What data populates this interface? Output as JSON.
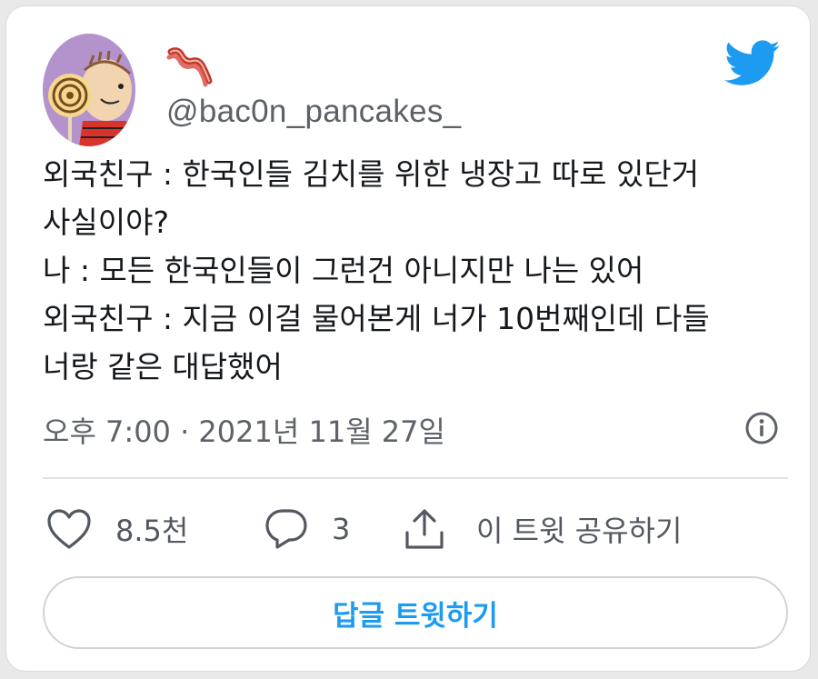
{
  "author": {
    "handle": "@bac0n_pancakes_",
    "display_name_icon": "bacon-emoji",
    "avatar": "linus-lollipop-avatar"
  },
  "brand": {
    "logo_icon": "twitter-bird-icon",
    "accent_color": "#1d9bf0"
  },
  "tweet": {
    "lines": [
      "외국친구 : 한국인들 김치를 위한 냉장고 따로 있단거",
      "사실이야?",
      "나 : 모든 한국인들이 그런건 아니지만 나는 있어",
      "외국친구 : 지금 이걸 물어본게 너가 10번째인데 다들",
      "너랑 같은 대답했어"
    ],
    "timestamp": "오후 7:00 · 2021년 11월 27일",
    "info_icon": "info-icon"
  },
  "actions": {
    "like_count": "8.5천",
    "reply_count": "3",
    "share_label": "이 트윗 공유하기"
  },
  "reply_button_label": "답글 트윗하기"
}
